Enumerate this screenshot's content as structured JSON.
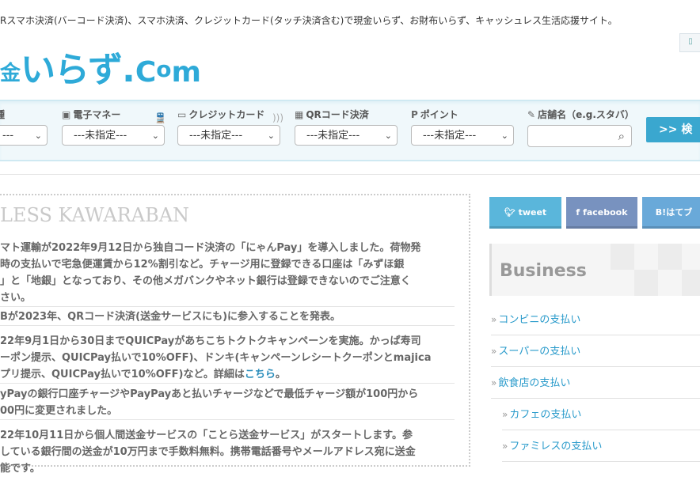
{
  "tagline": "Rスマホ決済(バーコード決済)、スマホ決済、クレジットカード(タッチ決済含む)で現金いらず、お財布いらず、キャッシュレス生活応援サイト。",
  "logo": {
    "kin": "金",
    "main": "いらず",
    "dot": ".",
    "c": "C",
    "o": "o",
    "m": "m"
  },
  "search": {
    "fields": [
      {
        "icon": "",
        "label": "種",
        "value": "---"
      },
      {
        "icon": "▣",
        "label": "電子マネー",
        "value": "---未指定---"
      },
      {
        "icon": "▭",
        "label": "クレジットカード",
        "value": "---未指定---"
      },
      {
        "icon": "▦",
        "label": "QRコード決済",
        "value": "---未指定---"
      },
      {
        "icon": "P",
        "label": "ポイント",
        "value": "---未指定---"
      }
    ],
    "store_label": "店舗名（e.g.スタバ）",
    "store_placeholder": "",
    "button": ">>  検"
  },
  "kawaraban": {
    "title": "LESS KAWARABAN",
    "news": [
      {
        "lines": [
          "マト運輸が2022年9月12日から独自コード決済の「にゃんPay」を導入しました。荷物発",
          "時の支払いで宅急便運賃から12%割引など。チャージ用に登録できる口座は「みずほ銀",
          "」と「地銀」となっており、その他メガバンクやネット銀行は登録できないのでご注意く",
          "さい。"
        ]
      },
      {
        "lines": [
          "Bが2023年、QRコード決済(送金サービスにも)に参入することを発表。"
        ]
      },
      {
        "lines": [
          "22年9月1日から30日までQUICPayがあちこちトクトクキャンペーンを実施。かっぱ寿司",
          "ーポン提示、QUICPay払いで10%OFF)、ドンキ(キャンペーンレシートクーポンとmajica",
          "プリ提示、QUICPay払いで10%OFF)など。詳細は"
        ],
        "link": "こちら",
        "tail": "。"
      },
      {
        "lines": [
          "yPayの銀行口座チャージやPayPayあと払いチャージなどで最低チャージ額が100円から",
          "00円に変更されました。"
        ]
      },
      {
        "lines": [
          "22年10月11日から個人間送金サービスの「ことら送金サービス」がスタートします。参",
          "している銀行間の送金が10万円まで手数料無料。携帯電話番号やメールアドレス宛に送金",
          "能です。"
        ]
      }
    ]
  },
  "social": {
    "tweet": "tweet",
    "facebook": "facebook",
    "hatena": "B!はてブ"
  },
  "sidebar": {
    "heading": "Business",
    "items": [
      "コンビニの支払い",
      "スーパーの支払い",
      "飲食店の支払い"
    ],
    "subitems": [
      "カフェの支払い",
      "ファミレスの支払い"
    ]
  }
}
